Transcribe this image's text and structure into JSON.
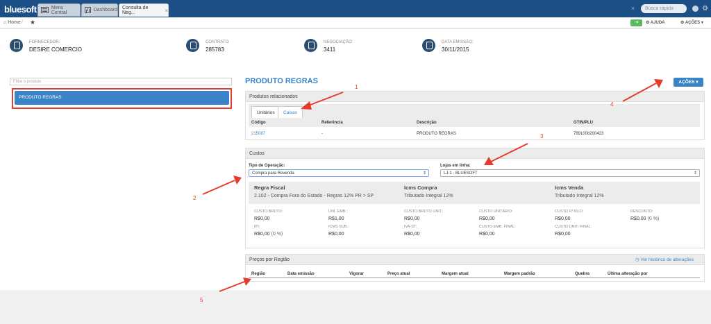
{
  "topbar": {
    "logo": "bluesoft",
    "tabs": [
      {
        "label": "Menu Central"
      },
      {
        "label": "Dashboard"
      },
      {
        "label": "Consulta de Neg..."
      }
    ],
    "search_placeholder": "Busca rápida"
  },
  "breadcrumb": {
    "home": "Home",
    "help": "AJUDA",
    "actions": "AÇÕES"
  },
  "info": {
    "fornecedor": {
      "label": "FORNECEDOR:",
      "value": "DESIRE COMERCIO"
    },
    "contrato": {
      "label": "CONTRATO:",
      "value": "285783"
    },
    "negociacao": {
      "label": "NEGOCIAÇÃO:",
      "value": "3411"
    },
    "data_emissao": {
      "label": "DATA EMISSÃO:",
      "value": "30/11/2015"
    }
  },
  "left": {
    "filter_placeholder": "Filtre o produto",
    "items": [
      {
        "label": "PRODUTO REGRAS"
      }
    ]
  },
  "page": {
    "title": "PRODUTO REGRAS",
    "actions_button": "AÇÕES"
  },
  "produtos": {
    "header": "Produtos relacionados",
    "tabs": [
      "Unitários",
      "Caixas"
    ],
    "columns": [
      "Código",
      "Referência",
      "Descrição",
      "GTIN/PLU"
    ],
    "rows": [
      {
        "codigo": "215087",
        "referencia": "-",
        "descricao": "PRODUTO REGRAS",
        "gtin": "7891008200423"
      }
    ]
  },
  "custos": {
    "header": "Custos",
    "tipo_label": "Tipo de Operação:",
    "tipo_value": "Compra para Revenda",
    "lojas_label": "Lojas em linha:",
    "lojas_value": "LJ-1 - BLUESOFT",
    "regra_fiscal_label": "Regra Fiscal",
    "regra_fiscal_value": "2.102 - Compra Fora do Estado - Regras 12% PR > SP",
    "icms_compra_label": "Icms Compra",
    "icms_compra_value": "Tributado Integral 12%",
    "icms_venda_label": "Icms Venda",
    "icms_venda_value": "Tributado Integral 12%",
    "metrics": [
      {
        "label": "CUSTO BRUTO:",
        "value": "R$0,00"
      },
      {
        "label": "UNI. EMB.:",
        "value": "R$1,00"
      },
      {
        "label": "CUSTO BRUTO UNIT.:",
        "value": "R$0,00"
      },
      {
        "label": "CUSTO UNITÁRIO:",
        "value": "R$0,00"
      },
      {
        "label": "CUSTO P/ KILO:",
        "value": "R$0,00"
      },
      {
        "label": "DESCONTO:",
        "value": "R$0,00",
        "extra": "(0 %)"
      },
      {
        "label": "IPI:",
        "value": "R$0,00",
        "extra": "(0 %)"
      },
      {
        "label": "ICMS SUB.:",
        "value": "R$0,00"
      },
      {
        "label": "IVA-ST:",
        "value": "R$0,00"
      },
      {
        "label": "CUSTO EMB. FINAL:",
        "value": "R$0,00"
      },
      {
        "label": "CUSTO UNIT. FINAL:",
        "value": "R$0,00"
      }
    ]
  },
  "precos": {
    "header": "Preços por Região",
    "history_link": "Ver histórico de alterações",
    "columns": [
      "Região",
      "Data emissão",
      "Vigorar",
      "Preço atual",
      "Margem atual",
      "Margem padrão",
      "Quebra",
      "Última alteração por"
    ]
  },
  "annotations": [
    "1",
    "2",
    "3",
    "4",
    "5"
  ],
  "colors": {
    "topbar": "#1b4f86",
    "accent": "#3b83c7",
    "annotation": "#e53b2c",
    "green": "#5cb85c"
  }
}
